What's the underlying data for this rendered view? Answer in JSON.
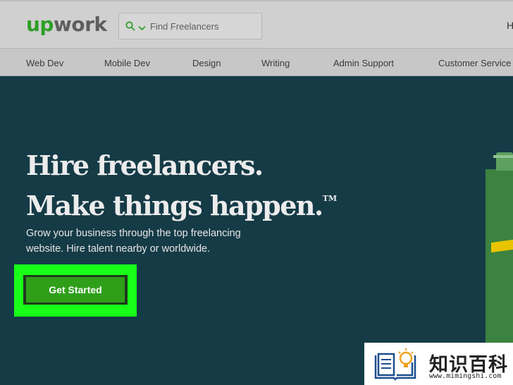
{
  "header": {
    "logo_prefix": "up",
    "logo_suffix": "work",
    "search": {
      "placeholder": "Find Freelancers"
    },
    "right_text": "H"
  },
  "categories": [
    {
      "label": "Web Dev"
    },
    {
      "label": "Mobile Dev"
    },
    {
      "label": "Design"
    },
    {
      "label": "Writing"
    },
    {
      "label": "Admin Support"
    },
    {
      "label": "Customer Service"
    }
  ],
  "hero": {
    "headline_line1": "Hire freelancers.",
    "headline_line2": "Make things happen.",
    "trademark": "TM",
    "description": "Grow your business through the top freelancing website. Hire talent nearby or worldwide.",
    "cta_label": "Get Started"
  },
  "watermark": {
    "text": "知识百科",
    "url": "www.mimingshi.com"
  },
  "colors": {
    "brand_green": "#2f9e28",
    "hero_background": "#153b47",
    "cta_button": "#2f9f1a",
    "highlight_outline": "#18ff18"
  }
}
